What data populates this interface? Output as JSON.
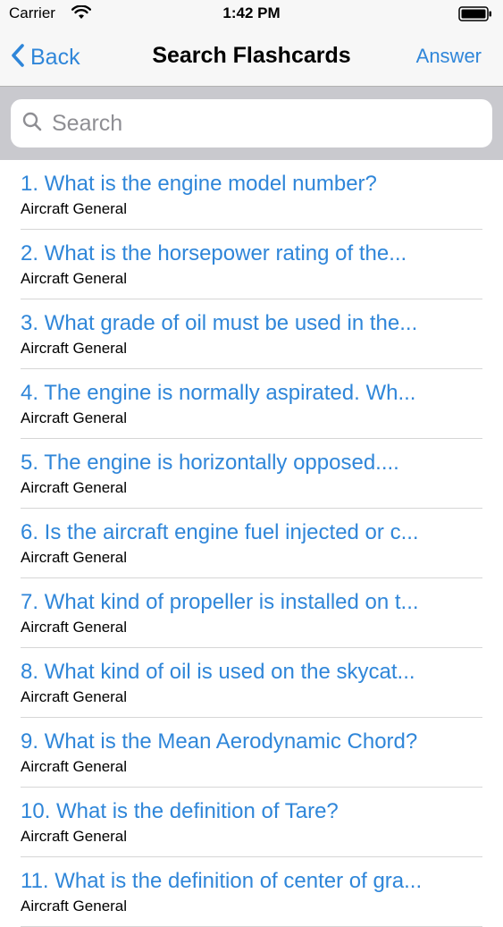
{
  "status_bar": {
    "carrier": "Carrier",
    "time": "1:42 PM"
  },
  "nav": {
    "back_label": "Back",
    "title": "Search Flashcards",
    "answer_label": "Answer"
  },
  "search": {
    "placeholder": "Search",
    "value": ""
  },
  "colors": {
    "accent": "#2f86d9",
    "search_bar_bg": "#c9c9ce"
  },
  "flashcards": [
    {
      "title": "1. What is the engine model number?",
      "category": "Aircraft General"
    },
    {
      "title": "2. What is the horsepower rating of the...",
      "category": "Aircraft General"
    },
    {
      "title": "3. What grade of oil must be used in the...",
      "category": "Aircraft General"
    },
    {
      "title": "4. The engine is normally aspirated. Wh...",
      "category": "Aircraft General"
    },
    {
      "title": "5. The engine is horizontally opposed....",
      "category": "Aircraft General"
    },
    {
      "title": "6. Is the aircraft engine fuel injected or c...",
      "category": "Aircraft General"
    },
    {
      "title": "7. What kind of propeller is installed on t...",
      "category": "Aircraft General"
    },
    {
      "title": "8. What kind of oil is used on the skycat...",
      "category": "Aircraft General"
    },
    {
      "title": "9. What is the Mean Aerodynamic Chord?",
      "category": "Aircraft General"
    },
    {
      "title": "10. What is the definition of Tare?",
      "category": "Aircraft General"
    },
    {
      "title": "11. What is the definition of center of gra...",
      "category": "Aircraft General"
    }
  ]
}
